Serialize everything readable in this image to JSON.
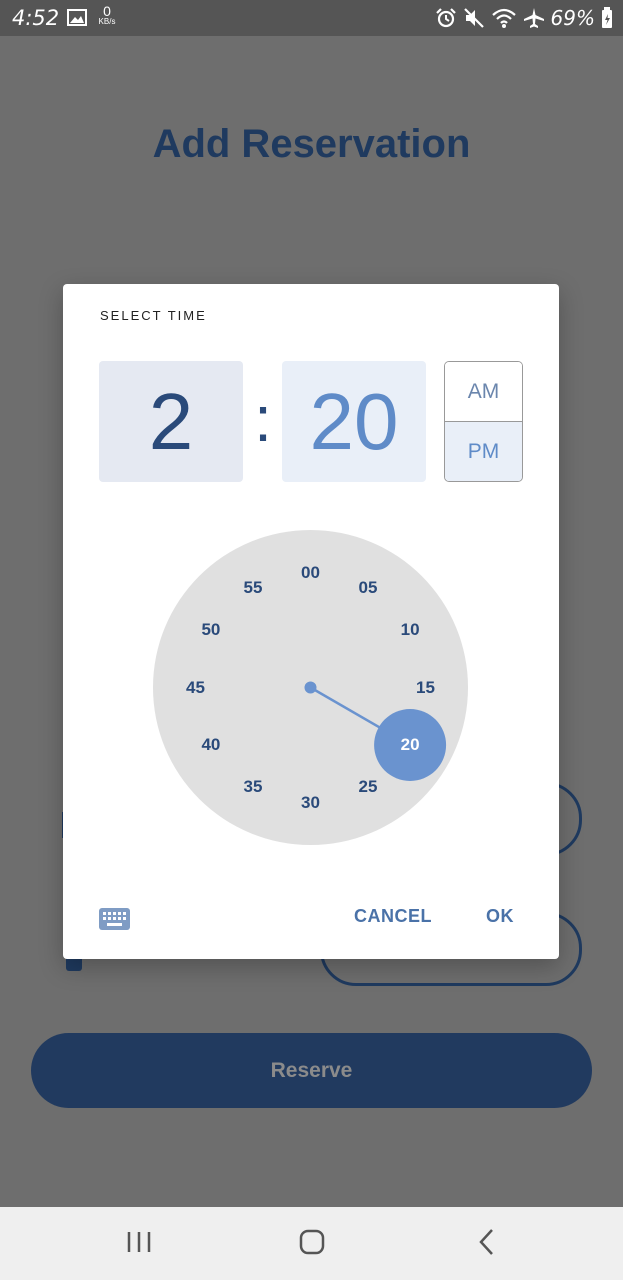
{
  "status_bar": {
    "time": "4:52",
    "speed_value": "0",
    "speed_unit": "KB/s",
    "battery": "69%",
    "icons": [
      "image-icon",
      "alarm-icon",
      "mute-icon",
      "wifi-icon",
      "airplane-icon",
      "battery-icon"
    ]
  },
  "page": {
    "title": "Add Reservation",
    "reserve_label": "Reserve"
  },
  "dialog": {
    "header": "SELECT TIME",
    "hour": "2",
    "separator": ":",
    "minute": "20",
    "am_label": "AM",
    "pm_label": "PM",
    "selected_period": "PM",
    "clock": {
      "labels": [
        "00",
        "05",
        "10",
        "15",
        "20",
        "25",
        "30",
        "35",
        "40",
        "45",
        "50",
        "55"
      ],
      "selected_minute": "20"
    },
    "keyboard_icon": "keyboard-icon",
    "cancel_label": "CANCEL",
    "ok_label": "OK"
  },
  "nav_bar": {
    "icons": [
      "recents-icon",
      "home-icon",
      "back-icon"
    ]
  },
  "colors": {
    "primary_dark": "#1f3a5f",
    "accent": "#6a93cf",
    "clock_face": "#e0e0e0",
    "overlay": "#6e6e6e"
  }
}
